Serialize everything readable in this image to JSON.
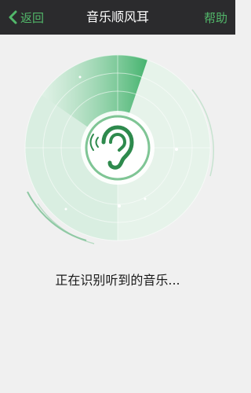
{
  "header": {
    "back_label": "返回",
    "title": "音乐顺风耳",
    "help_label": "帮助"
  },
  "status": {
    "text": "正在识别听到的音乐..."
  },
  "icons": {
    "back": "chevron-left-icon",
    "center": "ear-icon"
  },
  "colors": {
    "header_bg": "#2b2b2d",
    "accent": "#52b76a",
    "radar_light": "#cfe9d8",
    "radar_sweep": "#5cbf7e",
    "background": "#f0f0f0"
  }
}
